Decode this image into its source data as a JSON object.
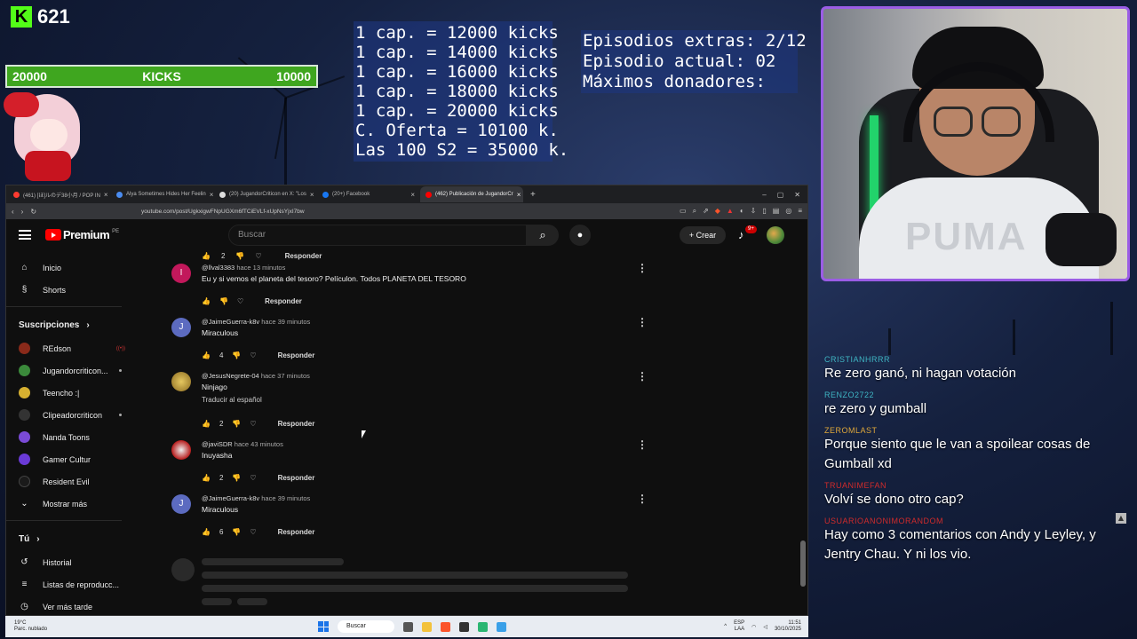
{
  "overlay": {
    "kick_count": "621",
    "kick_bar": {
      "left": "20000",
      "center": "KICKS",
      "right": "10000"
    },
    "caps": [
      "1 cap. = 12000 kicks",
      "1 cap. = 14000 kicks",
      "1 cap. = 16000 kicks",
      "1 cap. = 18000 kicks",
      "1 cap. = 20000 kicks",
      "C. Oferta = 10100 k.",
      "Las 100 S2 = 35000 k."
    ],
    "episodes": [
      "Episodios extras: 2/12",
      "Episodio actual: 02",
      "Máximos donadores:"
    ],
    "webcam_shirt_text": "PUMA"
  },
  "chat": [
    {
      "user": "CRISTIANHRRR",
      "color": "#3fb6c4",
      "text": "Re zero ganó, ni hagan votación"
    },
    {
      "user": "RENZO2722",
      "color": "#3fb6c4",
      "text": "re zero y gumball"
    },
    {
      "user": "ZEROMLAST",
      "color": "#e0a83a",
      "text": "Porque siento que le van a spoilear cosas de Gumball xd"
    },
    {
      "user": "TRUANIMEFAN",
      "color": "#d12b2b",
      "text": "Volví se dono otro cap?"
    },
    {
      "user": "USUARIOANONIMORANDOM",
      "color": "#d12b2b",
      "text": "Hay como 3 comentarios con Andy y Leyley, y Jentry Chau. Y ni los vio."
    }
  ],
  "browser": {
    "tabs": [
      {
        "label": "(461) [ほ]ルのデ38小月 / POP IN",
        "color": "#ff3b30",
        "active": false
      },
      {
        "label": "Alya Sometimes Hides Her Feelin",
        "color": "#4a8cf0",
        "active": false
      },
      {
        "label": "(20) JugandorCriticon en X: \"Los",
        "color": "#dddddd",
        "active": false
      },
      {
        "label": "(20+) Facebook",
        "color": "#1877f2",
        "active": false
      },
      {
        "label": "(462) Publicación de JugandorCr",
        "color": "#ff0000",
        "active": true
      }
    ],
    "url": "youtube.com/post/UgkxigwFNpUGXm6fTCiEVLf-xUpNsYjxI7bw",
    "win": {
      "min": "–",
      "max": "▢",
      "close": "✕"
    },
    "newtab": "+"
  },
  "youtube": {
    "brand": "Premium",
    "region": "PE",
    "search_placeholder": "Buscar",
    "create_label": "Crear",
    "notif_count": "9+",
    "sidebar": {
      "main": [
        {
          "label": "Inicio",
          "icon": "⌂"
        },
        {
          "label": "Shorts",
          "icon": "§"
        }
      ],
      "subs_title": "Suscripciones",
      "subs": [
        {
          "label": "REdson",
          "color": "#8a2a1a",
          "badge": "live"
        },
        {
          "label": "Jugandorcriticon...",
          "color": "#3b8a3b",
          "badge": "dot"
        },
        {
          "label": "Teencho :|",
          "color": "#d6b030",
          "badge": ""
        },
        {
          "label": "Clipeadorcriticon",
          "color": "#333333",
          "badge": "dot"
        },
        {
          "label": "Nanda Toons",
          "color": "#7a4ad6",
          "badge": ""
        },
        {
          "label": "Gamer Cultur",
          "color": "#6a3ad6",
          "badge": ""
        },
        {
          "label": "Resident Evil",
          "color": "#1a1a1a",
          "badge": ""
        }
      ],
      "more_label": "Mostrar más",
      "you_title": "Tú",
      "you": [
        {
          "label": "Historial",
          "icon": "↺"
        },
        {
          "label": "Listas de reproducc...",
          "icon": "≡"
        },
        {
          "label": "Ver más tarde",
          "icon": "◷"
        }
      ]
    },
    "top_actions": {
      "likes": "2",
      "reply": "Responder"
    },
    "comments": [
      {
        "author": "@llval3383",
        "ago": "hace 13 minutos",
        "text": "Eu y si vemos el planeta del tesoro? Películon. Todos PLANETA DEL TESORO",
        "translate": "",
        "likes": "",
        "avatar_letter": "I",
        "avatar_color": "#c2185b"
      },
      {
        "author": "@JaimeGuerra-k8v",
        "ago": "hace 39 minutos",
        "text": "Miraculous",
        "translate": "",
        "likes": "4",
        "avatar_letter": "J",
        "avatar_color": "#5c6bc0"
      },
      {
        "author": "@JesusNegrete-04",
        "ago": "hace 37 minutos",
        "text": "Ninjago",
        "translate": "Traducir al español",
        "likes": "2",
        "avatar_letter": "",
        "avatar_color": "#b8a040"
      },
      {
        "author": "@javiSDR",
        "ago": "hace 43 minutos",
        "text": "Inuyasha",
        "translate": "",
        "likes": "2",
        "avatar_letter": "",
        "avatar_color": "#b71c1c"
      },
      {
        "author": "@JaimeGuerra-k8v",
        "ago": "hace 39 minutos",
        "text": "Miraculous",
        "translate": "",
        "likes": "6",
        "avatar_letter": "J",
        "avatar_color": "#5c6bc0"
      }
    ],
    "reply_label": "Responder"
  },
  "taskbar": {
    "weather_temp": "19°C",
    "weather_desc": "Parc. nublado",
    "search": "Buscar",
    "lang": "ESP",
    "lang2": "LAA",
    "time": "11:51",
    "date": "30/10/2025"
  }
}
